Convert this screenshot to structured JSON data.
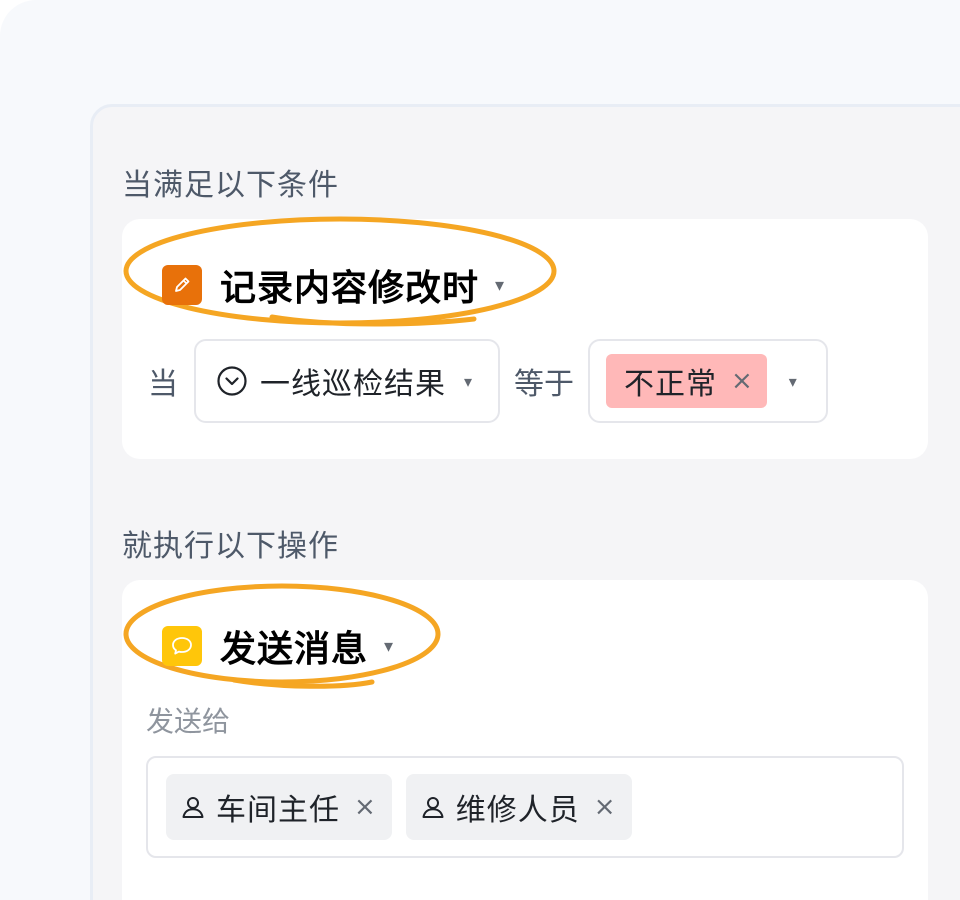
{
  "colors": {
    "trigger_icon_bg": "#e8710a",
    "action_icon_bg": "#ffc60a",
    "highlight_stroke": "#f5a623",
    "value_tag_bg": "#ffb8b8"
  },
  "trigger_section": {
    "label": "当满足以下条件",
    "trigger": {
      "icon": "edit-icon",
      "title": "记录内容修改时",
      "caret": "▾"
    },
    "condition": {
      "prefix": "当",
      "field": {
        "icon": "chevron-circle-icon",
        "name": "一线巡检结果",
        "caret": "▾"
      },
      "operator": "等于",
      "value": {
        "tag": "不正常",
        "close": "×",
        "caret": "▾"
      }
    }
  },
  "action_section": {
    "label": "就执行以下操作",
    "action": {
      "icon": "message-icon",
      "title": "发送消息",
      "caret": "▾"
    },
    "send_to_label": "发送给",
    "recipients": [
      {
        "icon": "user-icon",
        "name": "车间主任",
        "close": "×"
      },
      {
        "icon": "user-icon",
        "name": "维修人员",
        "close": "×"
      }
    ]
  }
}
